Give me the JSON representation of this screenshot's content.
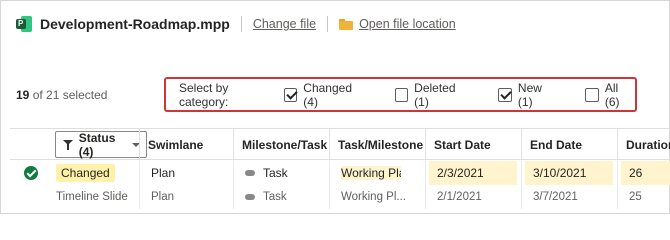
{
  "file": {
    "name": "Development-Roadmap.mpp",
    "change_link": "Change file",
    "open_location_link": "Open file location"
  },
  "selection": {
    "count": "19",
    "suffix": "of 21 selected"
  },
  "category_filter": {
    "label": "Select by category:",
    "options": [
      {
        "label": "Changed (4)",
        "checked": true
      },
      {
        "label": "Deleted (1)",
        "checked": false
      },
      {
        "label": "New (1)",
        "checked": true
      },
      {
        "label": "All (6)",
        "checked": false
      }
    ]
  },
  "table": {
    "status_filter_label": "Status (4)",
    "columns": [
      "Swimlane",
      "Milestone/Task",
      "Task/Milestone T",
      "Start Date",
      "End Date",
      "Duration"
    ],
    "rows": [
      {
        "status": "Changed",
        "swimlane": "Plan",
        "type": "Task",
        "name": "Working Plan",
        "start": "2/3/2021",
        "end": "3/10/2021",
        "duration": "26"
      },
      {
        "status": "Timeline Slide",
        "swimlane": "Plan",
        "type": "Task",
        "name": "Working Pl...",
        "start": "2/1/2021",
        "end": "3/7/2021",
        "duration": "25"
      }
    ]
  },
  "colors": {
    "accent_red": "#d13438",
    "highlight": "#fff4ce",
    "check_green": "#107c41"
  }
}
